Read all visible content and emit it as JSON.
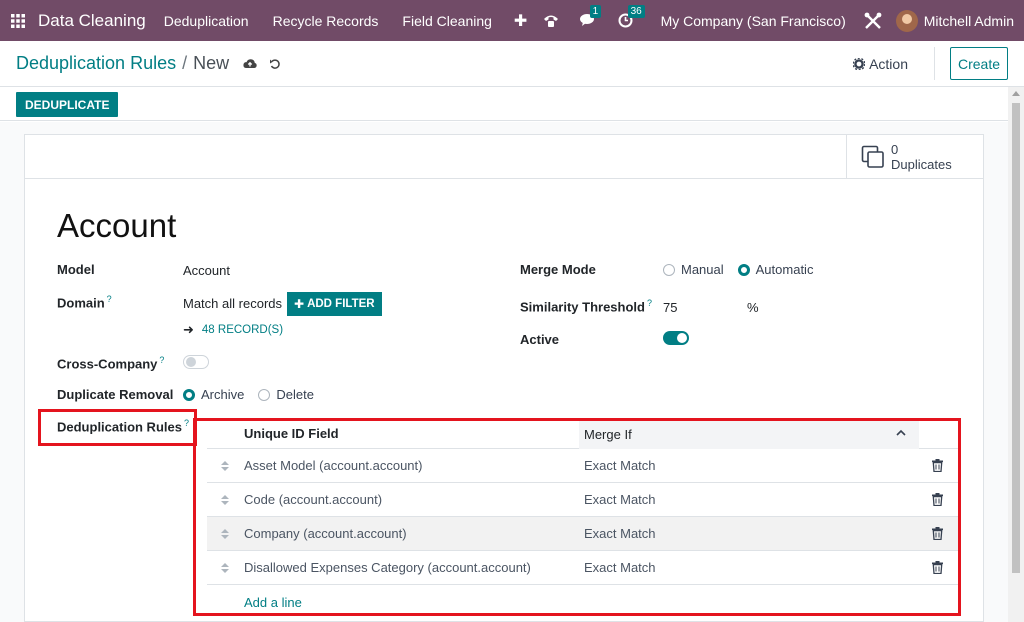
{
  "navbar": {
    "app_title": "Data Cleaning",
    "menu": [
      "Deduplication",
      "Recycle Records",
      "Field Cleaning"
    ],
    "messages_count": "1",
    "activities_count": "36",
    "company": "My Company (San Francisco)",
    "user": "Mitchell Admin"
  },
  "breadcrumb": {
    "parent": "Deduplication Rules",
    "separator": "/",
    "current": "New"
  },
  "control": {
    "action_label": "Action",
    "create_label": "Create"
  },
  "statusbar": {
    "deduplicate_label": "DEDUPLICATE"
  },
  "stat": {
    "value": "0",
    "label": "Duplicates"
  },
  "form": {
    "title": "Account",
    "model_label": "Model",
    "model_value": "Account",
    "domain_label": "Domain",
    "domain_match_prefix": "Match",
    "domain_match_value": "all records",
    "add_filter_label": "ADD FILTER",
    "records_label": "48 RECORD(S)",
    "cross_company_label": "Cross-Company",
    "duplicate_removal_label": "Duplicate Removal",
    "removal_options": [
      "Archive",
      "Delete"
    ],
    "removal_selected": "Archive",
    "dedup_rules_label": "Deduplication Rules",
    "merge_mode_label": "Merge Mode",
    "merge_options": [
      "Manual",
      "Automatic"
    ],
    "merge_selected": "Automatic",
    "similarity_label": "Similarity Threshold",
    "similarity_value": "75",
    "similarity_unit": "%",
    "active_label": "Active",
    "active": true,
    "cross_company": false,
    "help_mark": "?"
  },
  "rules_table": {
    "col_field": "Unique ID Field",
    "col_merge": "Merge If",
    "rows": [
      {
        "field": "Asset Model (account.account)",
        "merge": "Exact Match"
      },
      {
        "field": "Code (account.account)",
        "merge": "Exact Match"
      },
      {
        "field": "Company (account.account)",
        "merge": "Exact Match"
      },
      {
        "field": "Disallowed Expenses Category (account.account)",
        "merge": "Exact Match"
      }
    ],
    "add_line_label": "Add a line"
  },
  "colors": {
    "navbar": "#714b67",
    "accent": "#017e84",
    "highlight": "#e4141e"
  }
}
